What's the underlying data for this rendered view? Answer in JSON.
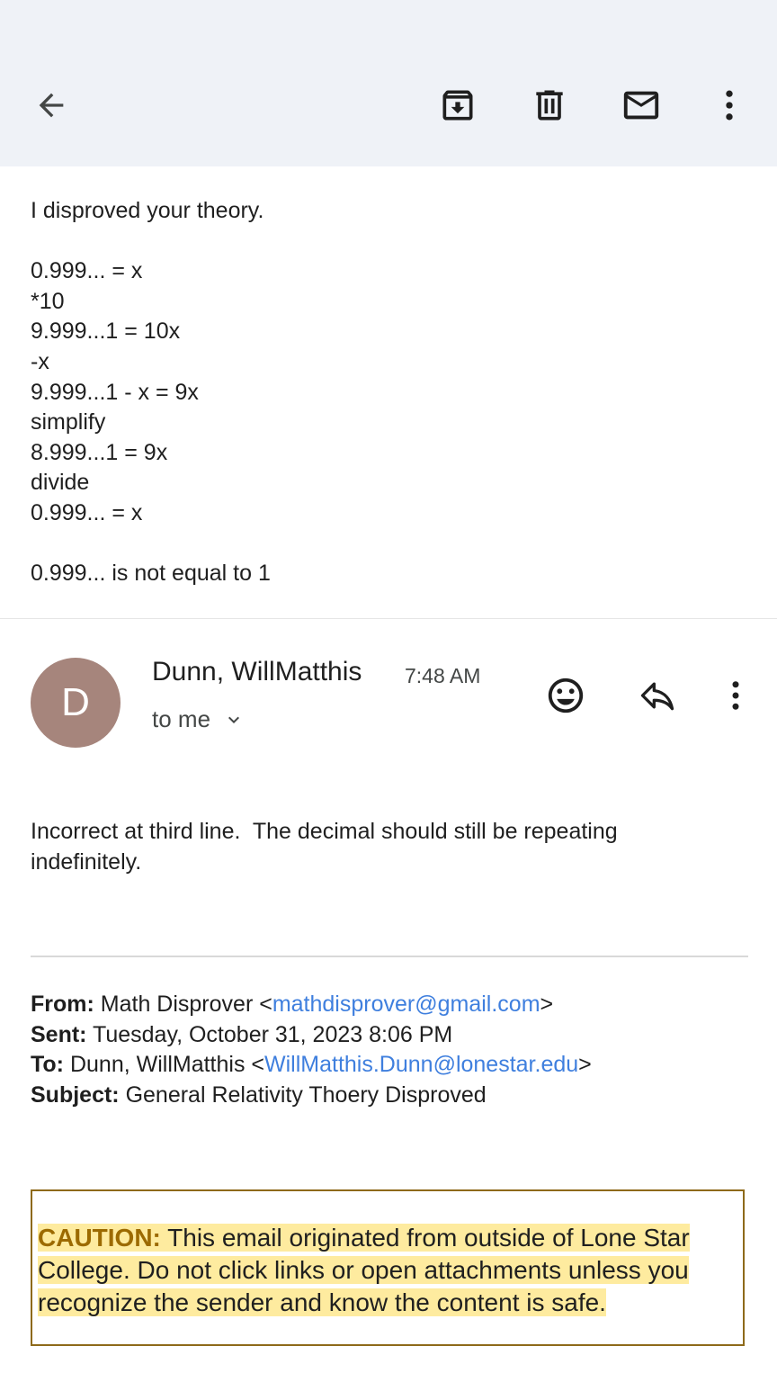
{
  "toolbar": {
    "back": "arrow-back-icon",
    "archive": "archive-icon",
    "delete": "trash-icon",
    "mark_unread": "mail-icon",
    "more": "more-vert-icon"
  },
  "quoted_message": {
    "lines": [
      "I disproved your theory.",
      "",
      "0.999... = x",
      "*10",
      "9.999...1 = 10x",
      "-x",
      "9.999...1 - x = 9x",
      "simplify",
      "8.999...1 = 9x",
      "divide",
      "0.999... = x",
      "",
      "0.999... is not equal to 1"
    ]
  },
  "message": {
    "avatar_letter": "D",
    "avatar_color": "#a6857c",
    "sender": "Dunn, WillMatthis",
    "time": "7:48 AM",
    "recipient": "to me",
    "body_line1": "Incorrect at third line.  The decimal should still be repeating",
    "body_line2": "indefinitely."
  },
  "forwarded": {
    "from_label": "From:",
    "from_name": " Math Disprover <",
    "from_email": "mathdisprover@gmail.com",
    "from_close": ">",
    "sent_label": "Sent:",
    "sent_value": " Tuesday, October 31, 2023 8:06 PM",
    "to_label": "To:",
    "to_name": " Dunn, WillMatthis <",
    "to_email": "WillMatthis.Dunn@lonestar.edu",
    "to_close": ">",
    "subject_label": "Subject:",
    "subject_value": " General Relativity Thoery Disproved"
  },
  "caution": {
    "label": "CAUTION:",
    "text": " This email originated from outside of Lone Star College. Do not click links or open attachments unless you recognize the sender and know the content is safe."
  },
  "colors": {
    "topbar_bg": "#eff2f7",
    "link": "#3f7fde",
    "caution_border": "#8e6a1a",
    "caution_highlight": "#feeb9f",
    "caution_label": "#9c6a00"
  }
}
